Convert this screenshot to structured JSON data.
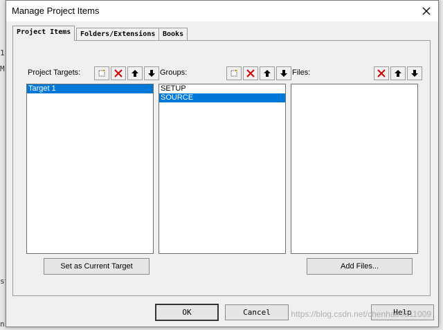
{
  "window": {
    "title": "Manage Project Items"
  },
  "tabs": [
    {
      "label": "Project Items",
      "active": true
    },
    {
      "label": "Folders/Extensions",
      "active": false
    },
    {
      "label": "Books",
      "active": false
    }
  ],
  "groups": [
    {
      "label": "Project Targets:",
      "tools": [
        "new-icon",
        "delete-icon",
        "move-up-icon",
        "move-down-icon"
      ],
      "items": [
        {
          "text": "Target 1",
          "selected": true
        }
      ]
    },
    {
      "label": "Groups:",
      "tools": [
        "new-icon",
        "delete-icon",
        "move-up-icon",
        "move-down-icon"
      ],
      "items": [
        {
          "text": "SETUP",
          "selected": false
        },
        {
          "text": "SOURCE",
          "selected": true
        }
      ]
    },
    {
      "label": "Files:",
      "tools": [
        "delete-icon",
        "move-up-icon",
        "move-down-icon"
      ],
      "items": []
    }
  ],
  "buttons": {
    "set_target": "Set as Current Target",
    "add_files": "Add Files...",
    "ok": "OK",
    "cancel": "Cancel",
    "help": "Help"
  },
  "watermark": "https://blog.csdn.net/chenhao0811009",
  "colors": {
    "selection": "#0078d7",
    "delete": "#cc0000"
  }
}
